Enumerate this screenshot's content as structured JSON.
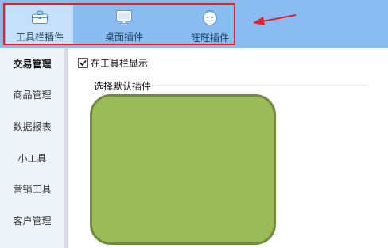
{
  "toolbar": {
    "tabs": [
      {
        "label": "工具栏插件",
        "icon": "toolbox-icon",
        "active": true
      },
      {
        "label": "桌面插件",
        "icon": "monitor-icon",
        "active": false
      },
      {
        "label": "旺旺插件",
        "icon": "wangwang-icon",
        "active": false
      }
    ]
  },
  "sidebar": {
    "items": [
      {
        "label": "交易管理",
        "active": true
      },
      {
        "label": "商品管理"
      },
      {
        "label": "数据报表"
      },
      {
        "label": "小工具"
      },
      {
        "label": "营销工具"
      },
      {
        "label": "客户管理"
      }
    ]
  },
  "main": {
    "show_in_toolbar": {
      "label": "在工具栏显示",
      "checked": true
    },
    "select_default_label": "选择默认插件"
  },
  "colors": {
    "toolbar_bg": "#89bcf1",
    "active_tab_bg": "#c6e0fb",
    "highlight_red": "#e11f2d",
    "preview_fill": "#9bbb59",
    "preview_border": "#6e8b3d"
  }
}
